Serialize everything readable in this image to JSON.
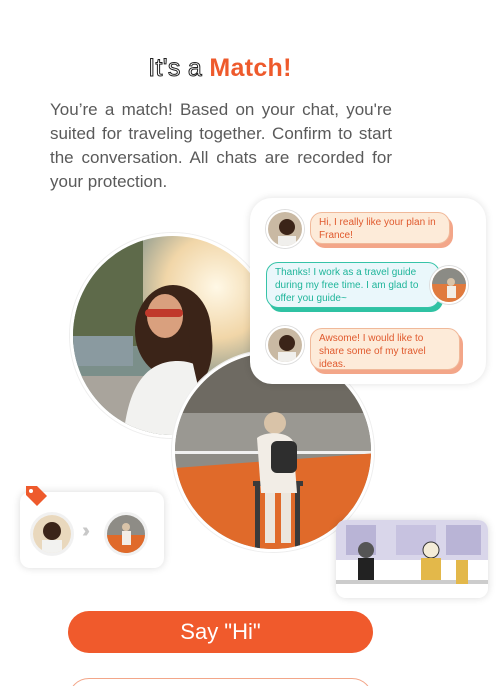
{
  "title": {
    "prefix": "It's a",
    "accent": "Match!"
  },
  "intro": "You’re a match! Based on your chat, you're suited for traveling together. Confirm to start the conversation. All chats are recorded for your protection.",
  "chat": [
    {
      "side": "left",
      "style": "peach",
      "text": "Hi, I really like your plan in France!"
    },
    {
      "side": "right",
      "style": "teal",
      "text": "Thanks! I work as a travel guide during my free time. I am glad to offer you guide~"
    },
    {
      "side": "left",
      "style": "peach",
      "text": "Awsome! I would like to share some of my travel ideas."
    }
  ],
  "icons": {
    "tag": "tag-icon",
    "chevrons": "double-chevron-right-icon"
  },
  "colors": {
    "accent": "#ee5a2c",
    "teal": "#2fc2a3",
    "peach": "#fdebd9"
  },
  "buttons": {
    "say_hi": "Say \"Hi\""
  }
}
